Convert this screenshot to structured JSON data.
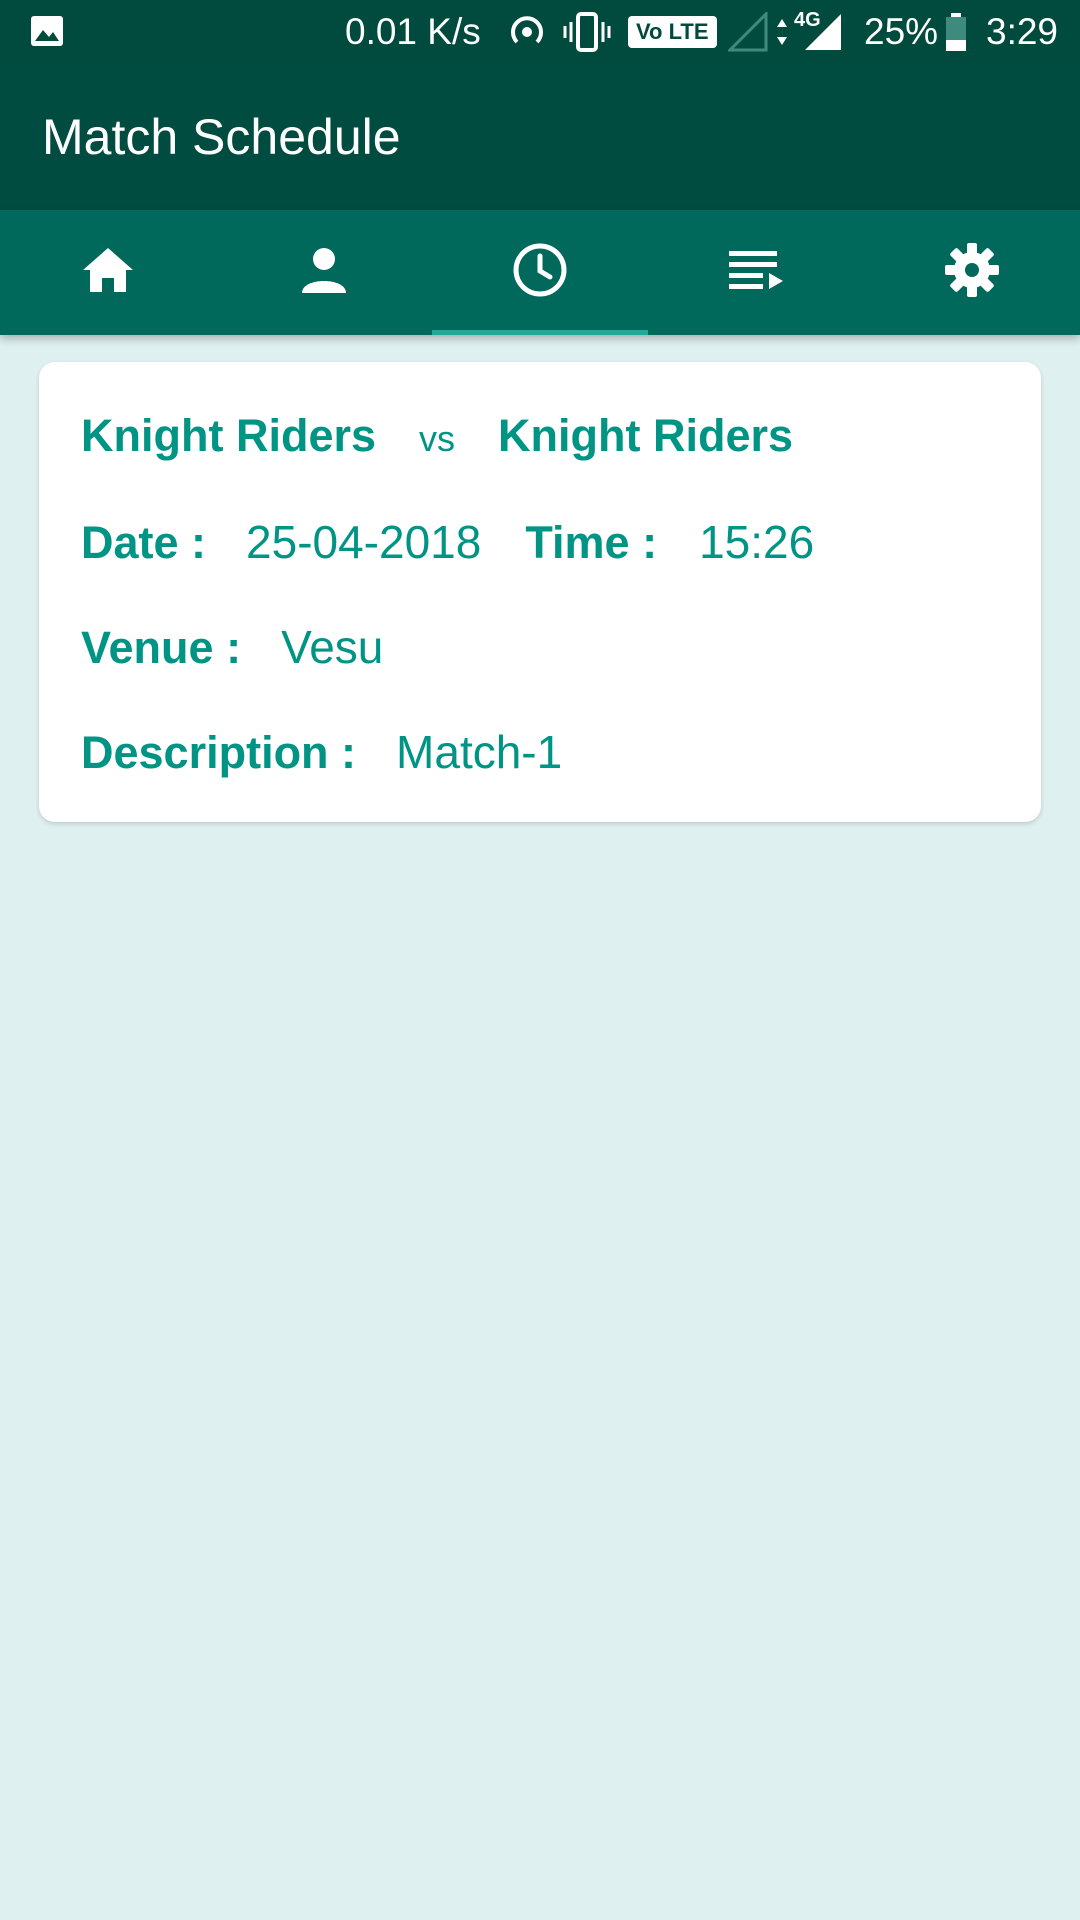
{
  "status_bar": {
    "net_speed": "0.01 K/s",
    "volte": "Vo LTE",
    "network": "4G",
    "battery": "25%",
    "time": "3:29"
  },
  "app_bar": {
    "title": "Match Schedule"
  },
  "tabs": [
    {
      "icon": "home-icon",
      "active": false
    },
    {
      "icon": "person-icon",
      "active": false
    },
    {
      "icon": "clock-icon",
      "active": true
    },
    {
      "icon": "playlist-icon",
      "active": false
    },
    {
      "icon": "settings-icon",
      "active": false
    }
  ],
  "match": {
    "team1": "Knight Riders",
    "vs": "vs",
    "team2": "Knight Riders",
    "date_label": "Date :",
    "date": "25-04-2018",
    "time_label": "Time :",
    "time": "15:26",
    "venue_label": "Venue :",
    "venue": "Vesu",
    "description_label": "Description :",
    "description": "Match-1"
  },
  "colors": {
    "status_bar": "#004a3e",
    "app_bar": "#004c40",
    "tab_bar": "#00695c",
    "tab_indicator": "#26a69a",
    "accent_text": "#009485",
    "background": "#dff0f0"
  }
}
